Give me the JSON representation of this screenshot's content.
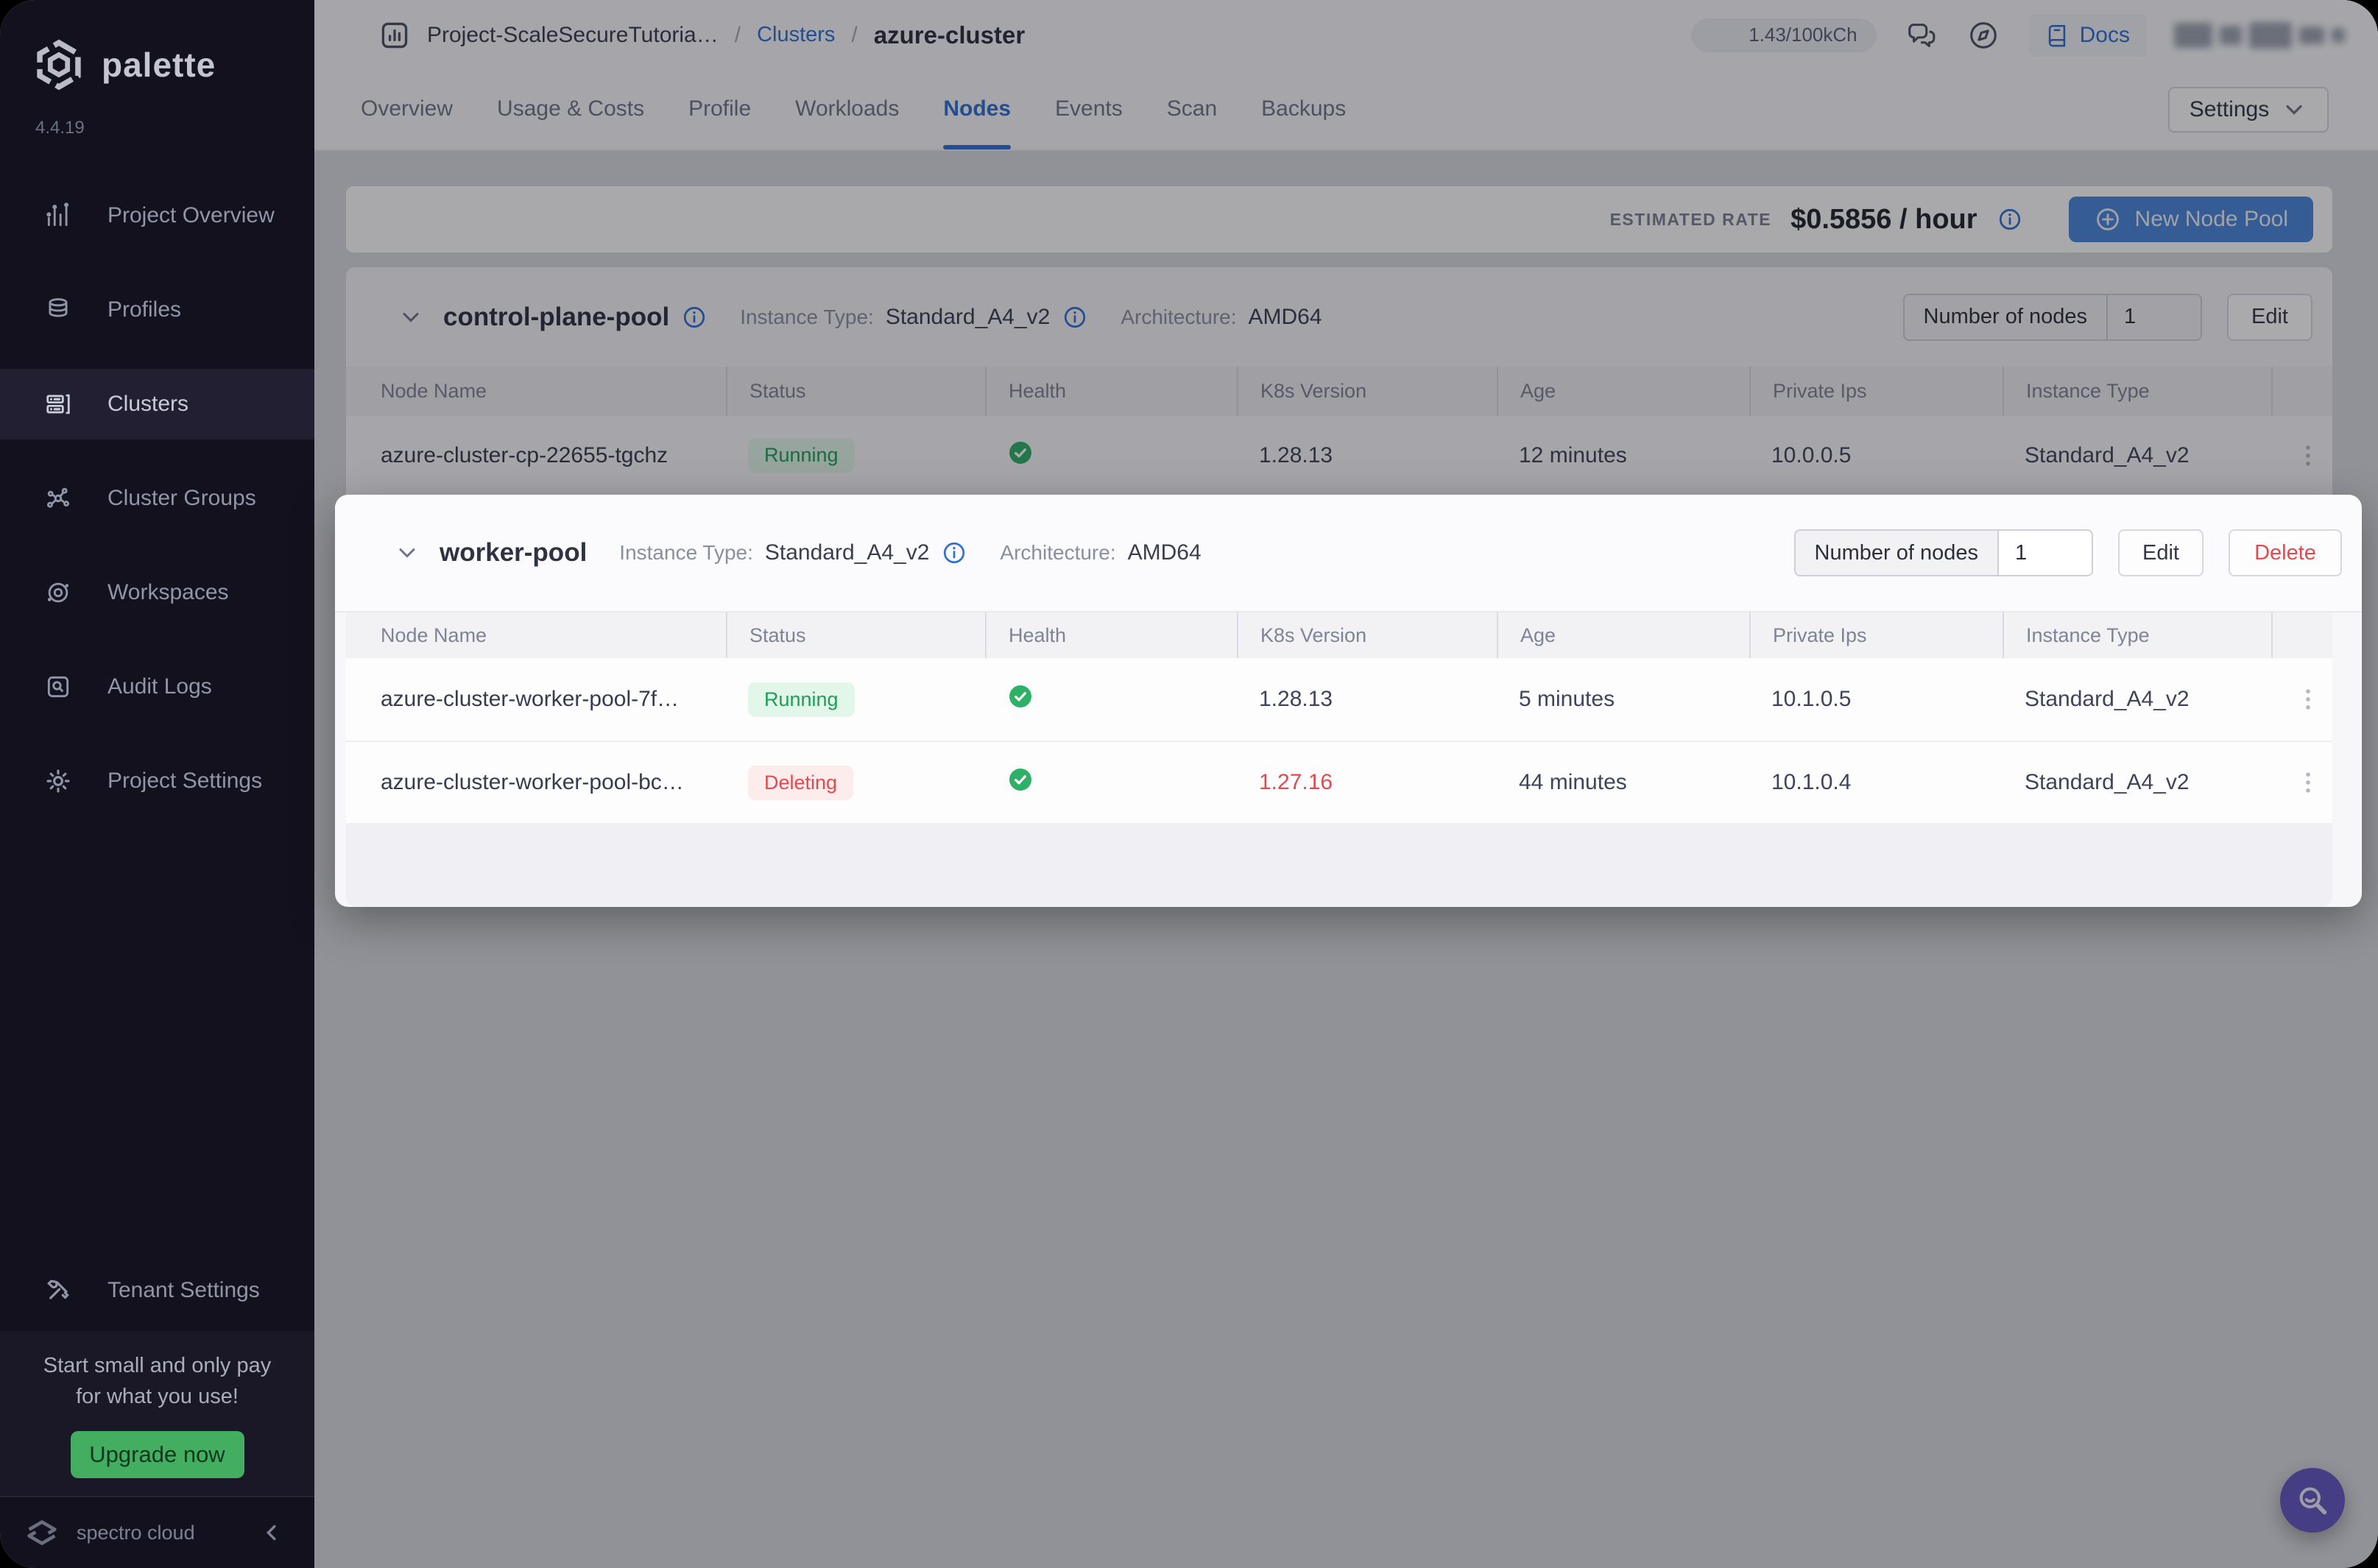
{
  "app": {
    "brand": "palette",
    "version": "4.4.19",
    "footer_brand": "spectro cloud"
  },
  "sidebar": {
    "items": [
      {
        "label": "Project Overview",
        "icon": "bar-chart-icon"
      },
      {
        "label": "Profiles",
        "icon": "layers-icon"
      },
      {
        "label": "Clusters",
        "icon": "server-icon"
      },
      {
        "label": "Cluster Groups",
        "icon": "network-icon"
      },
      {
        "label": "Workspaces",
        "icon": "orbit-icon"
      },
      {
        "label": "Audit Logs",
        "icon": "log-search-icon"
      },
      {
        "label": "Project Settings",
        "icon": "gear-icon"
      }
    ],
    "tenant_settings_label": "Tenant Settings",
    "promo_line1": "Start small and only pay",
    "promo_line2": "for what you use!",
    "upgrade_label": "Upgrade now"
  },
  "header": {
    "breadcrumb": {
      "project": "Project-ScaleSecureTutoria…",
      "separator": "/",
      "section": "Clusters",
      "current": "azure-cluster"
    },
    "usage_badge": "1.43/100kCh",
    "docs_label": "Docs"
  },
  "tabs": [
    {
      "label": "Overview"
    },
    {
      "label": "Usage & Costs"
    },
    {
      "label": "Profile"
    },
    {
      "label": "Workloads"
    },
    {
      "label": "Nodes"
    },
    {
      "label": "Events"
    },
    {
      "label": "Scan"
    },
    {
      "label": "Backups"
    }
  ],
  "settings_label": "Settings",
  "toolbar": {
    "estimated_rate_label": "ESTIMATED RATE",
    "rate_value": "$0.5856 / hour",
    "new_node_pool_label": "New Node Pool"
  },
  "table": {
    "columns": [
      "Node Name",
      "Status",
      "Health",
      "K8s Version",
      "Age",
      "Private Ips",
      "Instance Type"
    ]
  },
  "pools": [
    {
      "name": "control-plane-pool",
      "instance_type_label": "Instance Type:",
      "instance_type": "Standard_A4_v2",
      "architecture_label": "Architecture:",
      "architecture": "AMD64",
      "nodes_label": "Number of nodes",
      "nodes_value": "1",
      "edit_label": "Edit",
      "rows": [
        {
          "name": "azure-cluster-cp-22655-tgchz",
          "status": "Running",
          "k8s_version": "1.28.13",
          "age": "12 minutes",
          "private_ips": "10.0.0.5",
          "instance_type": "Standard_A4_v2"
        }
      ]
    },
    {
      "name": "worker-pool",
      "instance_type_label": "Instance Type:",
      "instance_type": "Standard_A4_v2",
      "architecture_label": "Architecture:",
      "architecture": "AMD64",
      "nodes_label": "Number of nodes",
      "nodes_value": "1",
      "edit_label": "Edit",
      "delete_label": "Delete",
      "rows": [
        {
          "name": "azure-cluster-worker-pool-7f…",
          "status": "Running",
          "k8s_version": "1.28.13",
          "age": "5 minutes",
          "private_ips": "10.1.0.5",
          "instance_type": "Standard_A4_v2"
        },
        {
          "name": "azure-cluster-worker-pool-bc…",
          "status": "Deleting",
          "k8s_version": "1.27.16",
          "age": "44 minutes",
          "private_ips": "10.1.0.4",
          "instance_type": "Standard_A4_v2"
        }
      ]
    }
  ],
  "colors": {
    "accent_blue": "#2e6fd0",
    "button_blue": "#4c86dc",
    "success_green": "#1e9e59",
    "danger_red": "#e5484d",
    "upgrade_green": "#43ae5f",
    "fab_purple": "#6558c0",
    "sidebar_bg": "#13111d"
  }
}
